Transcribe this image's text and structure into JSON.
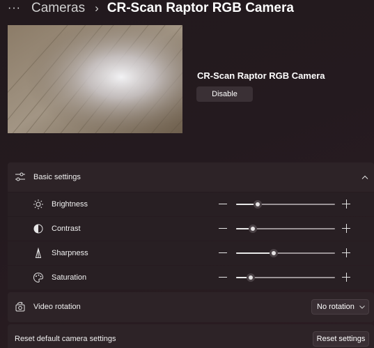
{
  "breadcrumb": {
    "more_label": "···",
    "parent": "Cameras",
    "separator": "›",
    "current": "CR-Scan Raptor RGB Camera"
  },
  "camera": {
    "name": "CR-Scan Raptor RGB Camera",
    "disable_label": "Disable"
  },
  "basic_settings": {
    "title": "Basic settings",
    "expanded": true,
    "items": [
      {
        "label": "Brightness",
        "icon": "brightness-icon",
        "value_fraction": 0.22
      },
      {
        "label": "Contrast",
        "icon": "contrast-icon",
        "value_fraction": 0.17
      },
      {
        "label": "Sharpness",
        "icon": "sharpness-icon",
        "value_fraction": 0.38
      },
      {
        "label": "Saturation",
        "icon": "saturation-icon",
        "value_fraction": 0.15
      }
    ]
  },
  "video_rotation": {
    "label": "Video rotation",
    "selected": "No rotation"
  },
  "reset": {
    "label": "Reset default camera settings",
    "button_label": "Reset settings"
  },
  "colors": {
    "accent_thumb": "#e5e2e3",
    "card_bg": "#2d2327",
    "row_bg": "#281f23"
  }
}
